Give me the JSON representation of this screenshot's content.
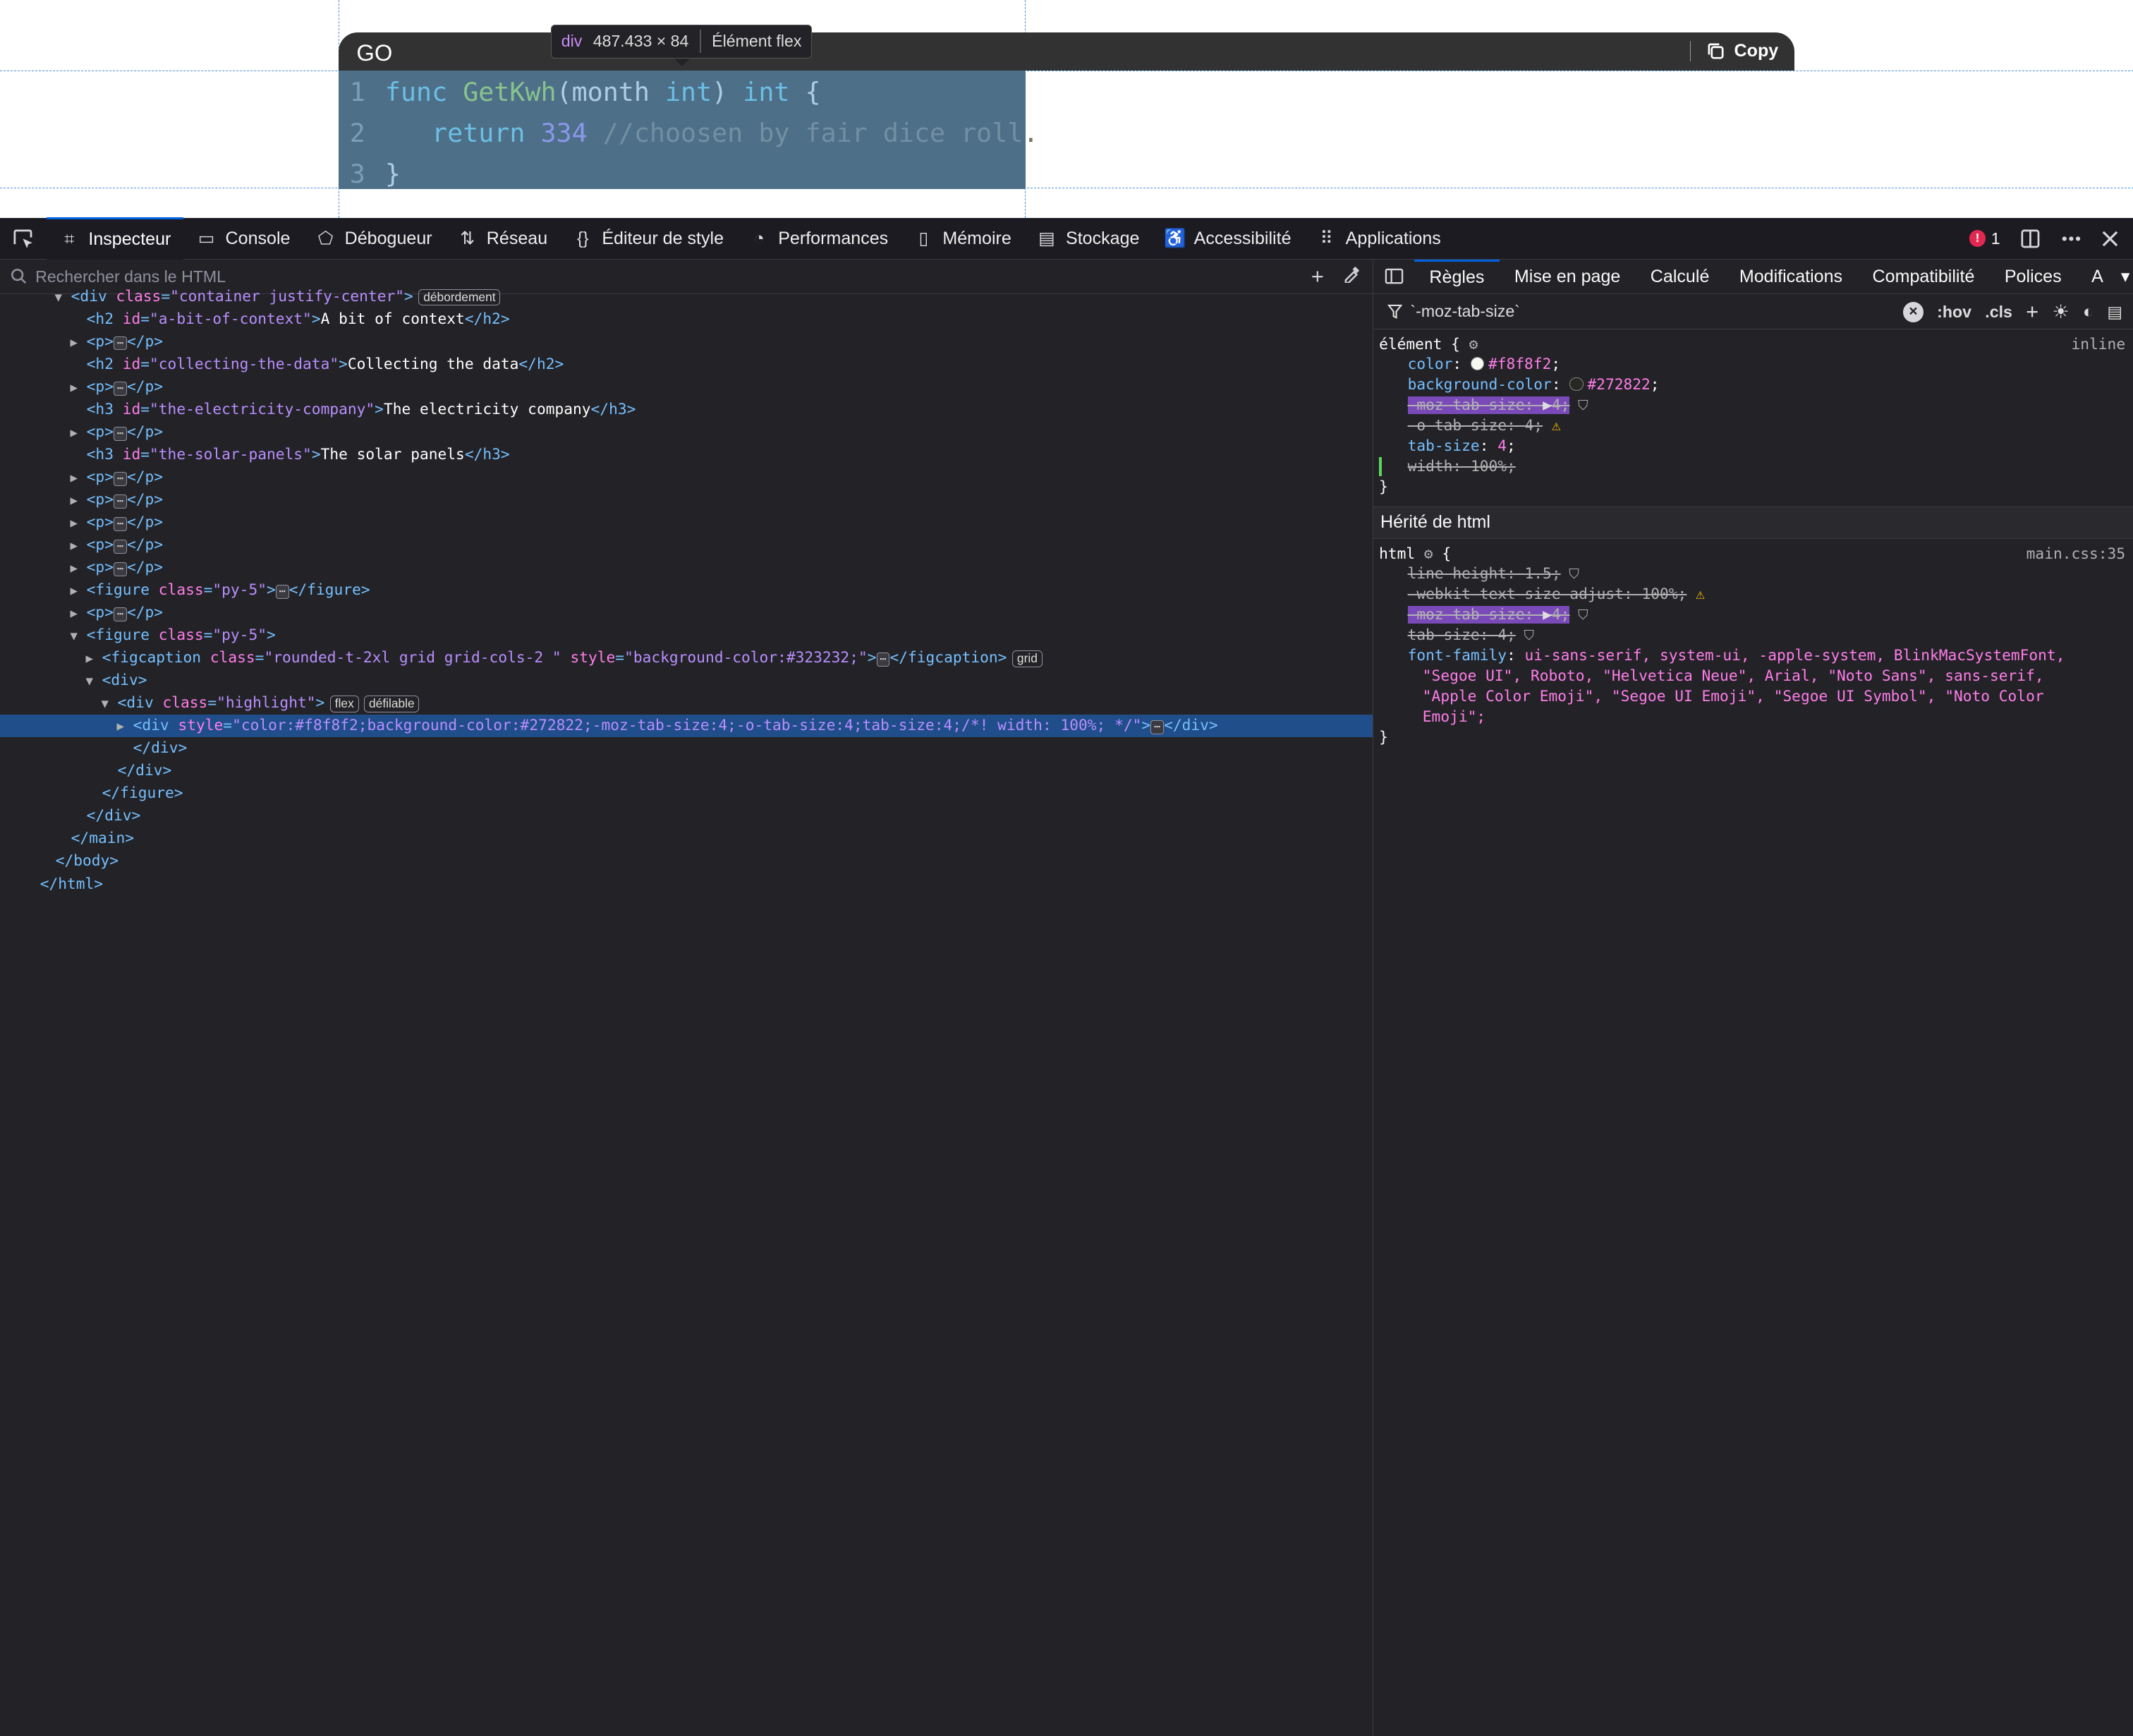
{
  "page": {
    "code_block": {
      "language": "GO",
      "copy_label": "Copy",
      "lines": [
        {
          "num": "1",
          "parts": [
            [
              "kw",
              "func "
            ],
            [
              "fn",
              "GetKwh"
            ],
            [
              "pn",
              "("
            ],
            [
              "pn",
              "month "
            ],
            [
              "kw",
              "int"
            ],
            [
              "pn",
              ") "
            ],
            [
              "kw",
              "int"
            ],
            [
              "pn",
              " {"
            ]
          ]
        },
        {
          "num": "2",
          "parts": [
            [
              "pn",
              "   "
            ],
            [
              "kw",
              "return "
            ],
            [
              "num",
              "334 "
            ],
            [
              "cm",
              "//choosen by fair dice roll."
            ]
          ]
        },
        {
          "num": "3",
          "parts": [
            [
              "pn",
              "}"
            ]
          ]
        }
      ]
    },
    "tooltip": {
      "tag": "div",
      "size": "487.433 × 84",
      "kind": "Élément flex"
    }
  },
  "toolbar": {
    "tabs": [
      {
        "label": "Inspecteur",
        "icon": "inspector-icon",
        "active": true
      },
      {
        "label": "Console",
        "icon": "console-icon"
      },
      {
        "label": "Débogueur",
        "icon": "debugger-icon"
      },
      {
        "label": "Réseau",
        "icon": "network-icon"
      },
      {
        "label": "Éditeur de style",
        "icon": "style-editor-icon"
      },
      {
        "label": "Performances",
        "icon": "performance-icon"
      },
      {
        "label": "Mémoire",
        "icon": "memory-icon"
      },
      {
        "label": "Stockage",
        "icon": "storage-icon"
      },
      {
        "label": "Accessibilité",
        "icon": "accessibility-icon"
      },
      {
        "label": "Applications",
        "icon": "applications-icon"
      }
    ],
    "error_count": "1"
  },
  "inspector": {
    "search_placeholder": "Rechercher dans le HTML",
    "rows": [
      {
        "indent": 3,
        "twisty": "v",
        "html": "<div class=\"container justify-center\">",
        "badge": "débordement"
      },
      {
        "indent": 4,
        "html": "<h2 id=\"a-bit-of-context\">A bit of context</h2>"
      },
      {
        "indent": 4,
        "twisty": ">",
        "html": "<p>…</p>"
      },
      {
        "indent": 4,
        "html": "<h2 id=\"collecting-the-data\">Collecting the data</h2>"
      },
      {
        "indent": 4,
        "twisty": ">",
        "html": "<p>…</p>"
      },
      {
        "indent": 4,
        "html": "<h3 id=\"the-electricity-company\">The electricity company</h3>"
      },
      {
        "indent": 4,
        "twisty": ">",
        "html": "<p>…</p>"
      },
      {
        "indent": 4,
        "html": "<h3 id=\"the-solar-panels\">The solar panels</h3>"
      },
      {
        "indent": 4,
        "twisty": ">",
        "html": "<p>…</p>"
      },
      {
        "indent": 4,
        "twisty": ">",
        "html": "<p>…</p>"
      },
      {
        "indent": 4,
        "twisty": ">",
        "html": "<p>…</p>"
      },
      {
        "indent": 4,
        "twisty": ">",
        "html": "<p>…</p>"
      },
      {
        "indent": 4,
        "twisty": ">",
        "html": "<p>…</p>"
      },
      {
        "indent": 4,
        "twisty": ">",
        "html": "<figure class=\"py-5\">…</figure>"
      },
      {
        "indent": 4,
        "twisty": ">",
        "html": "<p>…</p>"
      },
      {
        "indent": 4,
        "twisty": "v",
        "html": "<figure class=\"py-5\">"
      },
      {
        "indent": 5,
        "twisty": ">",
        "html": "<figcaption class=\"rounded-t-2xl grid grid-cols-2 \" style=\"background-color:#323232;\">…</figcaption>",
        "badge": "grid"
      },
      {
        "indent": 5,
        "twisty": "v",
        "html": "<div>"
      },
      {
        "indent": 6,
        "twisty": "v",
        "html": "<div class=\"highlight\">",
        "badge": "flex",
        "badge2": "défilable"
      },
      {
        "indent": 7,
        "twisty": ">",
        "html": "<div style=\"color:#f8f8f2;background-color:#272822;-moz-tab-size:4;-o-tab-size:4;tab-size:4;/*! width: 100%; */\">…</div>",
        "selected": true
      },
      {
        "indent": 7,
        "html": "</div>"
      },
      {
        "indent": 6,
        "html": "</div>"
      },
      {
        "indent": 5,
        "html": "</figure>"
      },
      {
        "indent": 4,
        "html": "</div>"
      },
      {
        "indent": 3,
        "html": "</main>"
      },
      {
        "indent": 2,
        "html": "</body>"
      },
      {
        "indent": 1,
        "html": "</html>"
      }
    ]
  },
  "rules_panel": {
    "tabs": [
      "Règles",
      "Mise en page",
      "Calculé",
      "Modifications",
      "Compatibilité",
      "Polices",
      "A"
    ],
    "active_tab": "Règles",
    "filter_value": "`-moz-tab-size`",
    "filter_buttons": [
      ":hov",
      ".cls"
    ],
    "element_rule": {
      "selector": "élément {",
      "source": "inline",
      "decls": [
        {
          "name": "color",
          "value": "#f8f8f2",
          "swatch": "#f8f8f2"
        },
        {
          "name": "background-color",
          "value": "#272822",
          "swatch": "#272822"
        },
        {
          "name": "-moz-tab-size",
          "value": "4",
          "overridden": true,
          "highlight": true
        },
        {
          "name": "-o-tab-size",
          "value": "4",
          "overridden": true,
          "warning": true
        },
        {
          "name": "tab-size",
          "value": "4"
        },
        {
          "name": "width",
          "value": "100%",
          "disabled": true
        }
      ]
    },
    "inherited_label": "Hérité de html",
    "html_rule": {
      "selector": "html",
      "source": "main.css:35",
      "decls": [
        {
          "name": "line-height",
          "value": "1.5",
          "overridden": true
        },
        {
          "name": "-webkit-text-size-adjust",
          "value": "100%",
          "overridden": true,
          "warning": true
        },
        {
          "name": "-moz-tab-size",
          "value": "4",
          "overridden": true,
          "highlight": true
        },
        {
          "name": "tab-size",
          "value": "4",
          "overridden": true
        }
      ],
      "font_family_name": "font-family",
      "font_family_lines": [
        "ui-sans-serif, system-ui, -apple-system, BlinkMacSystemFont,",
        "\"Segoe UI\", Roboto, \"Helvetica Neue\", Arial, \"Noto Sans\", sans-serif,",
        "\"Apple Color Emoji\", \"Segoe UI Emoji\", \"Segoe UI Symbol\", \"Noto Color",
        "Emoji\";"
      ]
    }
  }
}
